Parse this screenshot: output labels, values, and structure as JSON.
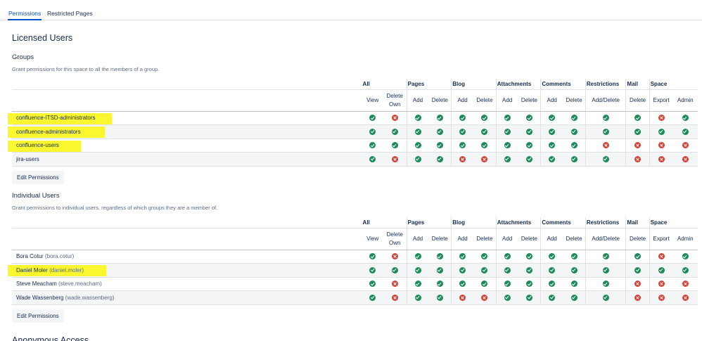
{
  "tabs": [
    {
      "label": "Permissions",
      "active": true
    },
    {
      "label": "Restricted Pages",
      "active": false
    }
  ],
  "licensed_users_title": "Licensed Users",
  "anonymous_title": "Anonymous Access",
  "highlight_color": "#faf731",
  "colors": {
    "allowed": "#1e8a59",
    "denied": "#d0453b",
    "accent": "#0052cc"
  },
  "icons": {
    "allowed": "check-circle-icon",
    "denied": "cross-circle-icon"
  },
  "column_groups": [
    "All",
    "Pages",
    "Blog",
    "Attachments",
    "Comments",
    "Restrictions",
    "Mail",
    "Space"
  ],
  "columns": [
    "View",
    "Delete Own",
    "Add",
    "Delete",
    "Add",
    "Delete",
    "Add",
    "Delete",
    "Add",
    "Delete",
    "Add/Delete",
    "Delete",
    "Export",
    "Admin"
  ],
  "groups_section": {
    "title": "Groups",
    "description": "Grant permissions for this space to all the members of a group.",
    "edit_label": "Edit Permissions",
    "rows": [
      {
        "name": "confluence-ITSD-administrators",
        "highlighted": true,
        "perms": [
          true,
          false,
          true,
          true,
          true,
          true,
          true,
          true,
          true,
          true,
          true,
          true,
          false,
          true
        ]
      },
      {
        "name": "confluence-administrators",
        "highlighted": true,
        "perms": [
          true,
          true,
          true,
          true,
          true,
          true,
          true,
          true,
          true,
          true,
          true,
          true,
          true,
          true
        ]
      },
      {
        "name": "confluence-users",
        "highlighted": true,
        "perms": [
          true,
          true,
          true,
          true,
          true,
          true,
          true,
          true,
          true,
          true,
          false,
          false,
          false,
          false
        ]
      },
      {
        "name": "jira-users",
        "highlighted": false,
        "perms": [
          true,
          false,
          true,
          true,
          false,
          false,
          true,
          true,
          true,
          true,
          true,
          false,
          false,
          false
        ]
      }
    ]
  },
  "users_section": {
    "title": "Individual Users",
    "description": "Grant permissions to individual users, regardless of which groups they are a member of.",
    "edit_label": "Edit Permissions",
    "rows": [
      {
        "name": "Bora Cotur",
        "username": "(bora.cotur)",
        "highlighted": false,
        "perms": [
          true,
          false,
          true,
          true,
          true,
          true,
          true,
          true,
          true,
          true,
          true,
          true,
          false,
          true
        ]
      },
      {
        "name": "Daniel Moler",
        "username": "(daniel.moler)",
        "highlighted": true,
        "perms": [
          true,
          true,
          true,
          true,
          true,
          true,
          true,
          true,
          true,
          true,
          true,
          true,
          true,
          true
        ]
      },
      {
        "name": "Steve Meacham",
        "username": "(steve.meacham)",
        "highlighted": false,
        "perms": [
          true,
          false,
          true,
          true,
          true,
          true,
          true,
          true,
          true,
          true,
          true,
          false,
          false,
          false
        ]
      },
      {
        "name": "Wade Wassenberg",
        "username": "(wade.wassenberg)",
        "highlighted": false,
        "perms": [
          true,
          false,
          true,
          true,
          false,
          false,
          true,
          true,
          true,
          true,
          true,
          false,
          false,
          false
        ]
      }
    ]
  }
}
